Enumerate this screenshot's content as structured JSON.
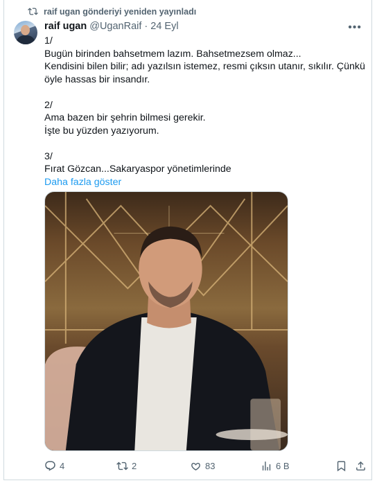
{
  "repost_text": "raif ugan gönderiyi yeniden yayınladı",
  "author": {
    "name": "raif ugan",
    "handle": "@UganRaif",
    "separator": "·",
    "date": "24 Eyl"
  },
  "more_label": "•••",
  "tweet": {
    "p1": "1/\nBugün birinden bahsetmem lazım. Bahsetmezsem olmaz...\nKendisini bilen bilir; adı yazılsın istemez, resmi çıksın utanır, sıkılır. Çünkü öyle hassas bir insandır.",
    "p2": "2/\nAma bazen bir şehrin bilmesi gerekir.\nİşte bu yüzden yazıyorum.",
    "p3": "3/\nFırat Gözcan...Sakaryaspor yönetimlerinde",
    "show_more": "Daha fazla göster"
  },
  "actions": {
    "replies": "4",
    "reposts": "2",
    "likes": "83",
    "views": "6 B"
  },
  "colors": {
    "accent": "#1d9bf0",
    "muted": "#536471",
    "text": "#0f1419"
  }
}
